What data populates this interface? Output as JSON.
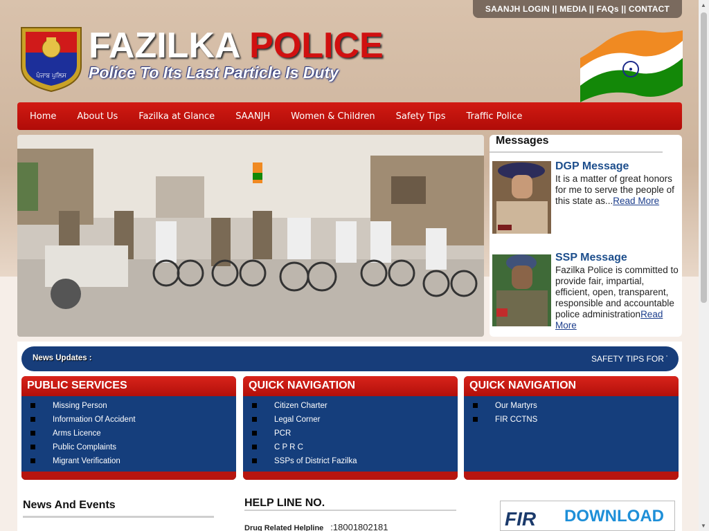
{
  "top_links": "SAANJH LOGIN || MEDIA || FAQs || CONTACT",
  "header": {
    "title_part1": "FAZILKA",
    "title_part2": "POLICE",
    "tagline": "Police To Its Last Particle Is Duty",
    "badge_text": "ਪੰਜਾਬ ਪੁਲਿਸ"
  },
  "nav": [
    "Home",
    "About Us",
    "Fazilka at Glance",
    "SAANJH",
    "Women & Children",
    "Safety Tips",
    "Traffic Police"
  ],
  "messages": {
    "heading": "Messages",
    "dgp": {
      "title": "DGP Message",
      "text": "It is a matter of great honors for me to serve the people of this state as...",
      "link": "Read More"
    },
    "ssp": {
      "title": "SSP Message",
      "text": "Fazilka Police is committed to provide fair, impartial, efficient, open, transparent, responsible and accountable police administration",
      "link": "Read More"
    }
  },
  "ticker": {
    "label": "News Updates  :",
    "text": "SAFETY TIPS FOR T"
  },
  "public_services": {
    "heading": "PUBLIC SERVICES",
    "items": [
      "Missing Person",
      "Information Of Accident",
      "Arms Licence",
      "Public Complaints",
      "Migrant Verification"
    ]
  },
  "quick_nav_1": {
    "heading": "QUICK NAVIGATION",
    "items": [
      "Citizen Charter",
      "Legal Corner",
      "PCR",
      "C P R C",
      "SSPs of District Fazilka"
    ]
  },
  "quick_nav_2": {
    "heading": "QUICK NAVIGATION",
    "items": [
      "Our Martyrs",
      "FIR CCTNS"
    ]
  },
  "news_events": {
    "heading": "News And Events"
  },
  "helpline": {
    "heading": "HELP LINE NO.",
    "label": "Drug Related Helpline",
    "number": ":18001802181"
  },
  "download": {
    "fir": "FIR",
    "label": "DOWNLOAD"
  }
}
